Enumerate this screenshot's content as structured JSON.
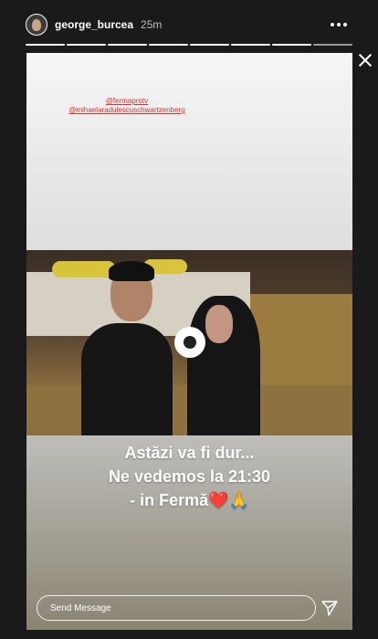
{
  "header": {
    "username": "george_burcea",
    "time": "25m"
  },
  "progress": {
    "segments": 8,
    "completed": 7
  },
  "icons": {
    "more": "more-options-icon",
    "close": "close-icon",
    "send": "send-icon",
    "play": "play-icon"
  },
  "story": {
    "mentions": [
      "@fermaprotv",
      "@mihaelaradulescuschwartzenberg"
    ],
    "caption_lines": [
      "Astăzi va fi dur...",
      "Ne vedemos la 21:30",
      "- in Fermă❤️🙏"
    ]
  },
  "composer": {
    "placeholder": "Send Message",
    "value": ""
  },
  "colors": {
    "mention": "#e03030",
    "background": "#1a1a1a"
  }
}
